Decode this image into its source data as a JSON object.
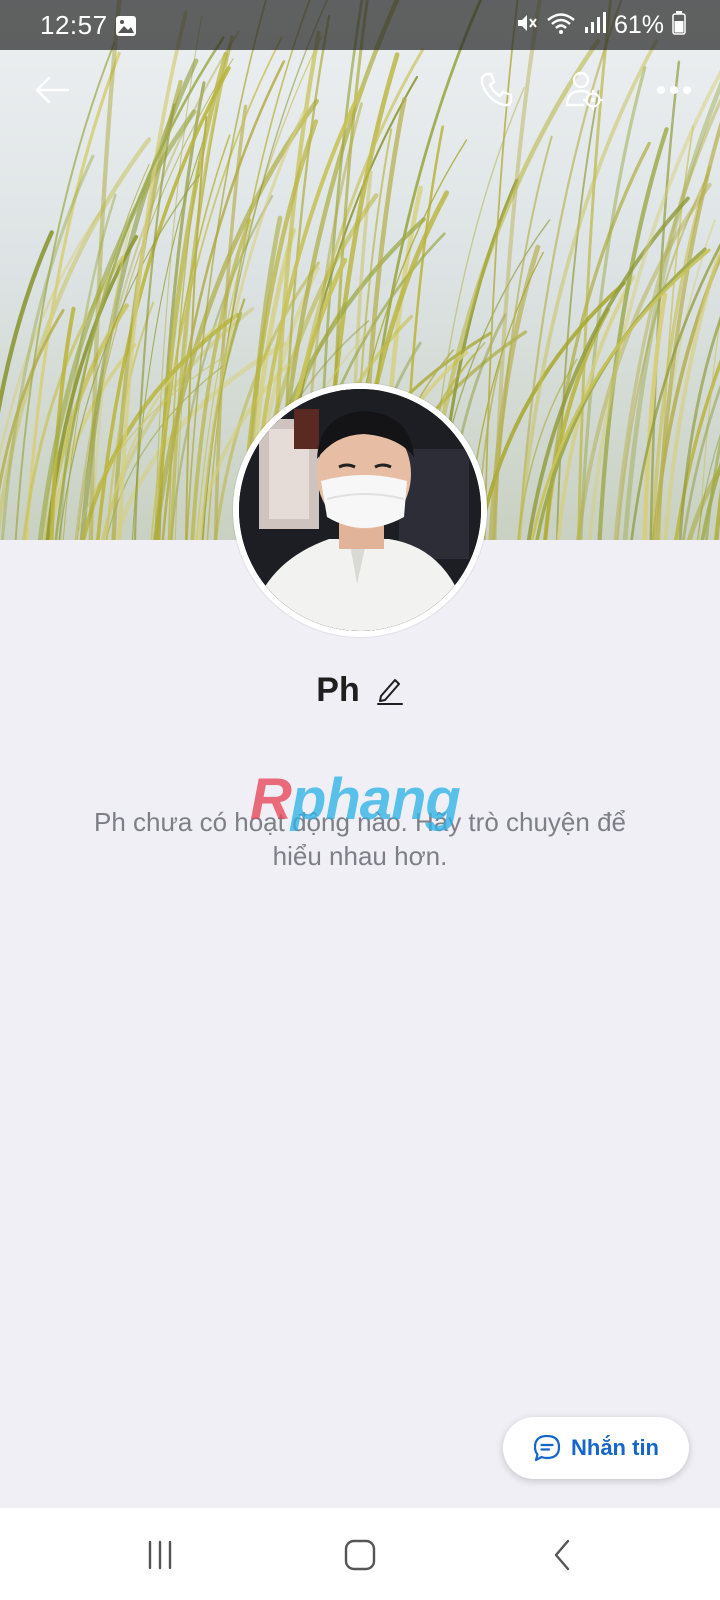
{
  "status_bar": {
    "time": "12:57",
    "battery": "61%",
    "icons": [
      "gallery-icon",
      "mute-icon",
      "wifi-icon",
      "signal-icon",
      "battery-icon"
    ]
  },
  "toolbar": {
    "icons": [
      "back-arrow-icon",
      "phone-call-icon",
      "user-settings-icon",
      "more-dots-icon"
    ]
  },
  "profile": {
    "name": "Ph",
    "empty_message": "Ph chưa có hoạt động nào. Hãy trò chuyện để hiểu nhau hơn."
  },
  "watermark": {
    "first": "R",
    "rest": "phang"
  },
  "message_button": {
    "label": "Nhắn tin",
    "color": "#1566c9"
  },
  "nav_bar": {
    "icons": [
      "recents-icon",
      "home-icon",
      "back-chevron-icon"
    ]
  },
  "colors": {
    "background": "#f0eff5",
    "accent": "#1566c9"
  }
}
